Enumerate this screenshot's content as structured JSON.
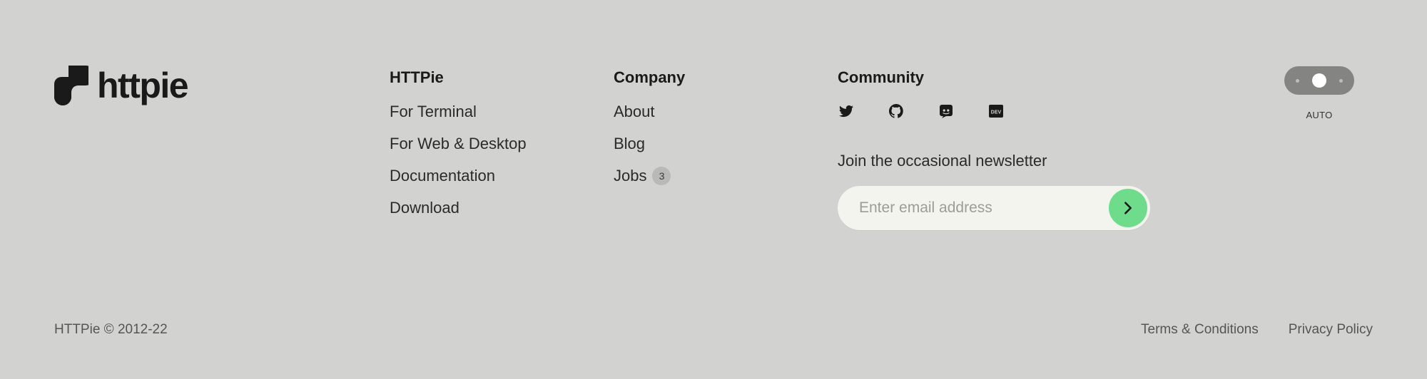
{
  "brand": {
    "logo_text": "httpie",
    "logo_icon": "httpie-logo-icon"
  },
  "columns": {
    "httpie": {
      "title": "HTTPie",
      "links": [
        "For Terminal",
        "For Web & Desktop",
        "Documentation",
        "Download"
      ]
    },
    "company": {
      "title": "Company",
      "links": [
        "About",
        "Blog",
        "Jobs"
      ],
      "jobs_count": "3"
    },
    "community": {
      "title": "Community",
      "social_icons": [
        "twitter-icon",
        "github-icon",
        "discord-icon",
        "dev-icon"
      ],
      "dev_icon_text": "DEV"
    }
  },
  "newsletter": {
    "label": "Join the occasional newsletter",
    "placeholder": "Enter email address",
    "submit_icon": "chevron-right-icon"
  },
  "theme": {
    "label": "AUTO"
  },
  "bottom": {
    "copyright": "HTTPie © 2012-22",
    "terms": "Terms & Conditions",
    "privacy": "Privacy Policy"
  },
  "colors": {
    "background": "#d2d2d0",
    "accent": "#6fdc8c",
    "input_bg": "#f4f4ee",
    "toggle_bg": "#848483"
  }
}
